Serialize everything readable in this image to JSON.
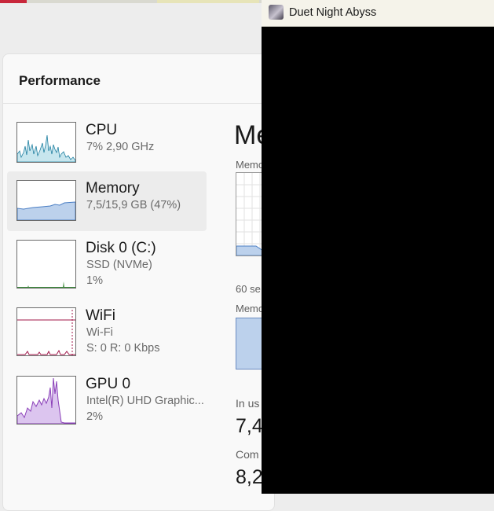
{
  "task_manager": {
    "header": {
      "title": "Performance"
    },
    "items": [
      {
        "name": "CPU",
        "lines": [
          "7%  2,90 GHz"
        ]
      },
      {
        "name": "Memory",
        "lines": [
          "7,5/15,9 GB (47%)"
        ]
      },
      {
        "name": "Disk 0 (C:)",
        "lines": [
          "SSD (NVMe)",
          "1%"
        ]
      },
      {
        "name": "WiFi",
        "lines": [
          "Wi-Fi",
          "S: 0  R: 0 Kbps"
        ]
      },
      {
        "name": "GPU 0",
        "lines": [
          "Intel(R) UHD Graphic...",
          "2%"
        ]
      }
    ],
    "detail": {
      "title": "Me",
      "usage_label": "Memo",
      "time_label": "60 se",
      "composition_label": "Memo",
      "in_use_label": "In us",
      "in_use_value": "7,4",
      "committed_label": "Com",
      "committed_value": "8,2,"
    },
    "colors": {
      "cpu": "#1f7fa0",
      "memory": "#4a7ec4",
      "gpu": "#8a3fb8",
      "wifi": "#a0174a",
      "disk": "#3b8a3a"
    }
  },
  "game_window": {
    "title": "Duet Night Abyss",
    "icon": "game-app-icon"
  }
}
